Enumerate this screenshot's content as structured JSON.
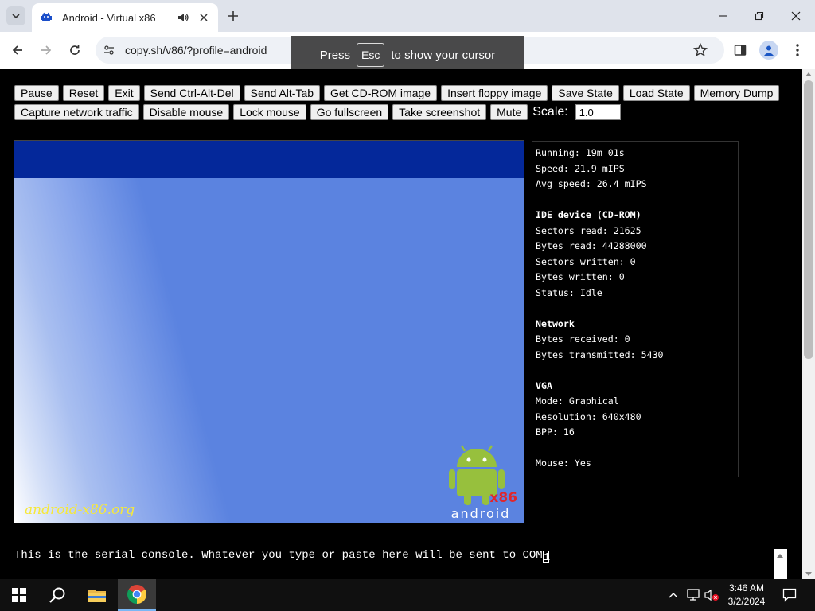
{
  "browser": {
    "tab_title": "Android - Virtual x86",
    "url": "copy.sh/v86/?profile=android"
  },
  "cursor_toast": {
    "press": "Press",
    "key": "Esc",
    "rest": "to show your cursor"
  },
  "controls": {
    "row1": [
      "Pause",
      "Reset",
      "Exit",
      "Send Ctrl-Alt-Del",
      "Send Alt-Tab",
      "Get CD-ROM image",
      "Insert floppy image",
      "Save State",
      "Load State",
      "Memory Dump"
    ],
    "row2": [
      "Capture network traffic",
      "Disable mouse",
      "Lock mouse",
      "Go fullscreen",
      "Take screenshot",
      "Mute"
    ],
    "scale_label": "Scale:",
    "scale_value": "1.0"
  },
  "screen": {
    "brand_text": "android-x86.org",
    "logo_x86": "x86",
    "logo_word": "android",
    "colors": {
      "top_bar": "#04289a",
      "background": "#5b83e0",
      "droid": "#97c03d",
      "x86": "#e0262c"
    }
  },
  "stats": {
    "running": "Running: 19m 01s",
    "speed": "Speed: 21.9 mIPS",
    "avg_speed": "Avg speed: 26.4 mIPS",
    "ide_heading": "IDE device (CD-ROM)",
    "sectors_read": "Sectors read: 21625",
    "bytes_read": "Bytes read: 44288000",
    "sectors_written": "Sectors written: 0",
    "bytes_written": "Bytes written: 0",
    "status": "Status: Idle",
    "network_heading": "Network",
    "bytes_received": "Bytes received: 0",
    "bytes_transmitted": "Bytes transmitted: 5430",
    "vga_heading": "VGA",
    "mode": "Mode: Graphical",
    "resolution": "Resolution: 640x480",
    "bpp": "BPP: 16",
    "mouse": "Mouse: Yes"
  },
  "serial_console": {
    "text": "This is the serial console. Whatever you type or paste here will be sent to COM",
    "caret_char": "1"
  },
  "taskbar": {
    "time": "3:46 AM",
    "date": "3/2/2024",
    "apps": [
      "start-icon",
      "search-icon",
      "file-explorer-icon",
      "chrome-icon"
    ]
  }
}
